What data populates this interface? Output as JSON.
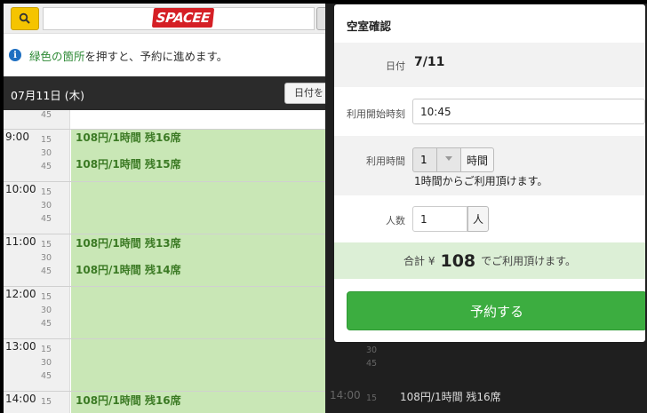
{
  "header": {
    "logo_text": "SPACEE",
    "search_icon": "search-icon"
  },
  "info": {
    "icon": "info-icon",
    "highlight": "緑色の箇所",
    "rest": "を押すと、予約に進めます。"
  },
  "datebar": {
    "date": "07月11日 (木)",
    "button_label": "日付を"
  },
  "schedule": {
    "hours": [
      {
        "label": "",
        "minutes": [
          "45"
        ]
      },
      {
        "label": "9:00",
        "minutes": [
          "15",
          "30",
          "45"
        ]
      },
      {
        "label": "10:00",
        "minutes": [
          "15",
          "30",
          "45"
        ]
      },
      {
        "label": "11:00",
        "minutes": [
          "15",
          "30",
          "45"
        ]
      },
      {
        "label": "12:00",
        "minutes": [
          "15",
          "30",
          "45"
        ]
      },
      {
        "label": "13:00",
        "minutes": [
          "15",
          "30",
          "45"
        ]
      },
      {
        "label": "14:00",
        "minutes": [
          "15"
        ]
      }
    ],
    "slots": [
      "108円/1時間 残16席",
      "108円/1時間 残15席",
      "108円/1時間 残13席",
      "108円/1時間 残14席",
      "108円/1時間 残16席"
    ],
    "background_slot": {
      "time": "14:00",
      "minute": "15",
      "text": "108円/1時間 残16席"
    },
    "background_minutes": [
      "30",
      "45"
    ]
  },
  "modal": {
    "title": "空室確認",
    "date_label": "日付",
    "date_value": "7/11",
    "start_label": "利用開始時刻",
    "start_value": "10:45",
    "duration_label": "利用時間",
    "duration_value": "1",
    "duration_unit": "時間",
    "duration_note": "1時間からご利用頂けます。",
    "people_label": "人数",
    "people_value": "1",
    "people_unit": "人",
    "total_prefix": "合計 ¥",
    "total_amount": "108",
    "total_suffix": "でご利用頂けます。",
    "reserve_button": "予約する"
  },
  "colors": {
    "accent_green": "#3cad40",
    "slot_green": "#c9e7b6",
    "logo_red": "#d51f25",
    "search_yellow": "#f5c400"
  }
}
